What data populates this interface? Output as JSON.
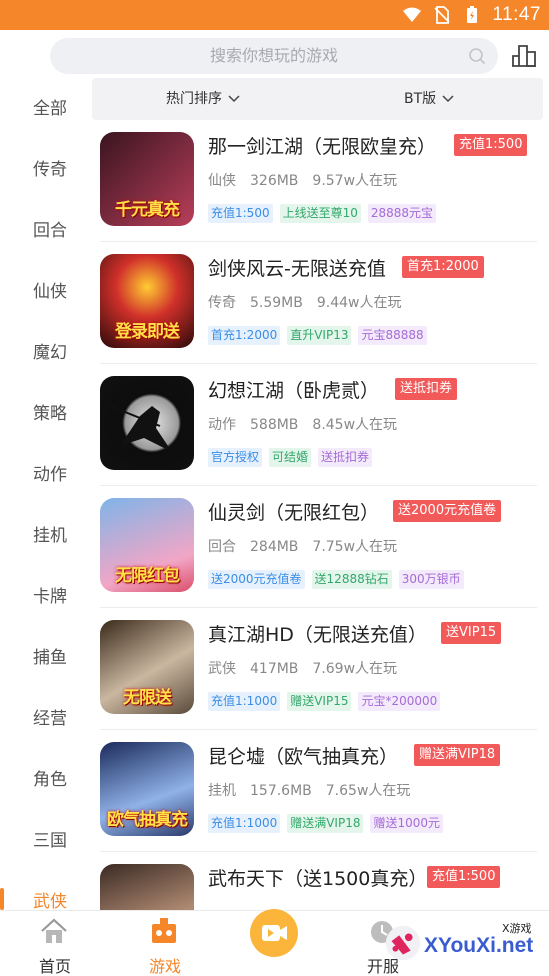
{
  "status_bar": {
    "time": "11:47"
  },
  "search": {
    "placeholder": "搜索你想玩的游戏"
  },
  "sidebar": {
    "items": [
      {
        "label": "全部"
      },
      {
        "label": "传奇"
      },
      {
        "label": "回合"
      },
      {
        "label": "仙侠"
      },
      {
        "label": "魔幻"
      },
      {
        "label": "策略"
      },
      {
        "label": "动作"
      },
      {
        "label": "挂机"
      },
      {
        "label": "卡牌"
      },
      {
        "label": "捕鱼"
      },
      {
        "label": "经营"
      },
      {
        "label": "角色"
      },
      {
        "label": "三国"
      },
      {
        "label": "武侠"
      }
    ],
    "active": "武侠"
  },
  "filters": {
    "sort_label": "热门排序",
    "version_label": "BT版"
  },
  "games": [
    {
      "title": "那一剑江湖（无限欧皇充）",
      "promo": "充值1:500",
      "category": "仙侠",
      "size": "326MB",
      "players": "9.57w人在玩",
      "tags": [
        "充值1:500",
        "上线送至尊10",
        "28888元宝"
      ],
      "thumb_text": "千元真充",
      "thumb_colors": [
        "#3a1420",
        "#b83f5a"
      ]
    },
    {
      "title": "剑侠风云-无限送充值",
      "promo": "首充1:2000",
      "category": "传奇",
      "size": "5.59MB",
      "players": "9.44w人在玩",
      "tags": [
        "首充1:2000",
        "直升VIP13",
        "元宝88888"
      ],
      "thumb_text": "登录即送",
      "thumb_colors": [
        "#2a0a0a",
        "#d0302a"
      ]
    },
    {
      "title": "幻想江湖（卧虎贰）",
      "promo": "送抵扣券",
      "category": "动作",
      "size": "588MB",
      "players": "8.45w人在玩",
      "tags": [
        "官方授权",
        "可结婚",
        "送抵扣券"
      ],
      "thumb_text": "",
      "thumb_colors": [
        "#0d0d0d",
        "#cfcfcf"
      ]
    },
    {
      "title": "仙灵剑（无限红包）",
      "promo": "送2000元充值卷",
      "category": "回合",
      "size": "284MB",
      "players": "7.75w人在玩",
      "tags": [
        "送2000元充值卷",
        "送12888钻石",
        "300万银币"
      ],
      "thumb_text": "无限红包",
      "thumb_colors": [
        "#7fb4e8",
        "#f2a6c6"
      ]
    },
    {
      "title": "真江湖HD（无限送充值）",
      "promo": "送VIP15",
      "category": "武侠",
      "size": "417MB",
      "players": "7.69w人在玩",
      "tags": [
        "充值1:1000",
        "赠送VIP15",
        "元宝*200000"
      ],
      "thumb_text": "无限送",
      "thumb_colors": [
        "#3a2a1a",
        "#c9b7a0"
      ]
    },
    {
      "title": "昆仑墟（欧气抽真充）",
      "promo": "赠送满VIP18",
      "category": "挂机",
      "size": "157.6MB",
      "players": "7.65w人在玩",
      "tags": [
        "充值1:1000",
        "赠送满VIP18",
        "赠送1000元"
      ],
      "thumb_text": "欧气抽真充",
      "thumb_colors": [
        "#1b2a5a",
        "#8fb2e8"
      ]
    },
    {
      "title": "武布天下（送1500真充）",
      "promo": "充值1:500",
      "category": "",
      "size": "",
      "players": "",
      "tags": [],
      "thumb_text": "",
      "thumb_colors": [
        "#3a2a24",
        "#b08a72"
      ]
    }
  ],
  "bottom_nav": {
    "items": [
      {
        "label": "首页",
        "icon": "home-icon"
      },
      {
        "label": "游戏",
        "icon": "game-icon"
      },
      {
        "label": "",
        "icon": "video-icon"
      },
      {
        "label": "开服",
        "icon": "clock-icon"
      }
    ]
  },
  "watermark": {
    "text": "XYouXi.net",
    "small": "X游戏"
  },
  "colors": {
    "accent": "#f5862a",
    "promo": "#f25a5a"
  }
}
